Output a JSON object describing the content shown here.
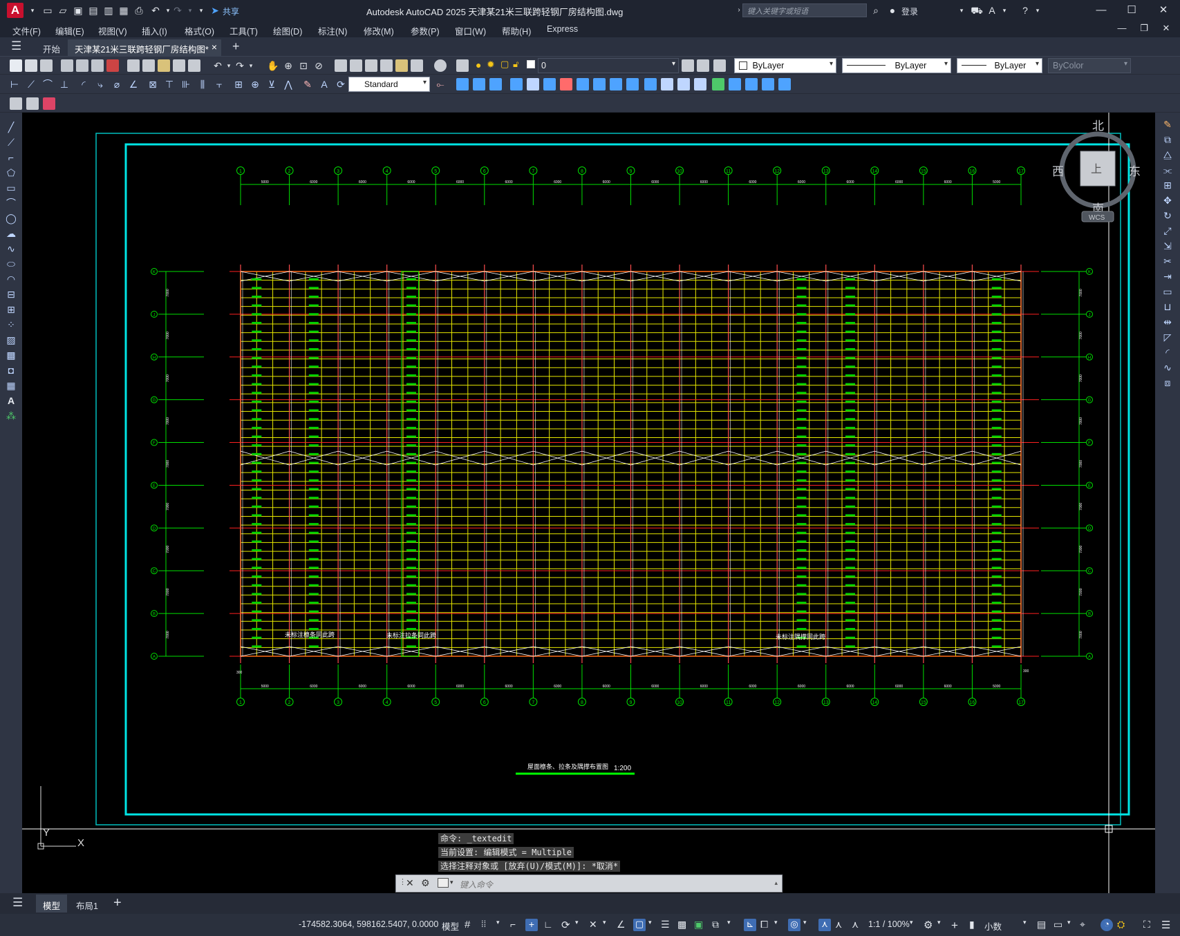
{
  "app": {
    "logo": "A",
    "title": "Autodesk AutoCAD 2025    天津某21米三联跨轻钢厂房结构图.dwg",
    "share": "共享",
    "search_placeholder": "键入关键字或短语",
    "login": "登录"
  },
  "menu": [
    "文件(F)",
    "编辑(E)",
    "视图(V)",
    "插入(I)",
    "格式(O)",
    "工具(T)",
    "绘图(D)",
    "标注(N)",
    "修改(M)",
    "参数(P)",
    "窗口(W)",
    "帮助(H)",
    "Express"
  ],
  "tabs": {
    "start": "开始",
    "drawing": "天津某21米三联跨轻钢厂房结构图*",
    "close": "×",
    "add": "+"
  },
  "properties": {
    "layer": "0",
    "color": "ByLayer",
    "linetype": "ByLayer",
    "lineweight": "ByLayer",
    "plotstyle": "ByColor",
    "textstyle": "Standard"
  },
  "viewcube": {
    "north": "北",
    "south": "南",
    "east": "东",
    "west": "西",
    "top": "上",
    "wcs": "WCS"
  },
  "ucs": {
    "x": "X",
    "y": "Y"
  },
  "drawing": {
    "axis_numbers": [
      "1",
      "2",
      "3",
      "4",
      "5",
      "6",
      "7",
      "8",
      "9",
      "10",
      "11",
      "12",
      "13",
      "14",
      "15",
      "16",
      "17"
    ],
    "row_letters": [
      "A",
      "B",
      "C",
      "D",
      "E",
      "F",
      "G",
      "H",
      "J",
      "K"
    ],
    "bay_dim": "6000",
    "bay_dims_top": [
      "5000",
      "6000",
      "6000",
      "6000",
      "6000",
      "6000",
      "6000",
      "6000",
      "6000",
      "6000",
      "6000",
      "6000",
      "6000",
      "6000",
      "6000",
      "5000"
    ],
    "bay_dims_bottom": [
      "5000",
      "6000",
      "6000",
      "6000",
      "6000",
      "6000",
      "6000",
      "6000",
      "6000",
      "6000",
      "6000",
      "6000",
      "6000",
      "6000",
      "6000",
      "5000"
    ],
    "row_dim": "7000",
    "note1": "未标注檩条同此跨",
    "note2": "未标注拉条同此跨",
    "note3": "未标注隅撑同此跨",
    "plan_title": "屋面檩条、拉条及隅撑布置图",
    "scale": "1:200",
    "end_dim": "300"
  },
  "command": {
    "history": [
      "命令: _textedit",
      "当前设置: 编辑模式 = Multiple",
      "选择注释对象或 [放弃(U)/模式(M)]: *取消*"
    ],
    "placeholder": "键入命令"
  },
  "layouts": {
    "menu": "☰",
    "model": "模型",
    "layout1": "布局1",
    "add": "+"
  },
  "status": {
    "coords": "-174582.3064, 598162.5407, 0.0000",
    "space": "模型",
    "scale": "1:1 / 100%",
    "units": "小数"
  }
}
